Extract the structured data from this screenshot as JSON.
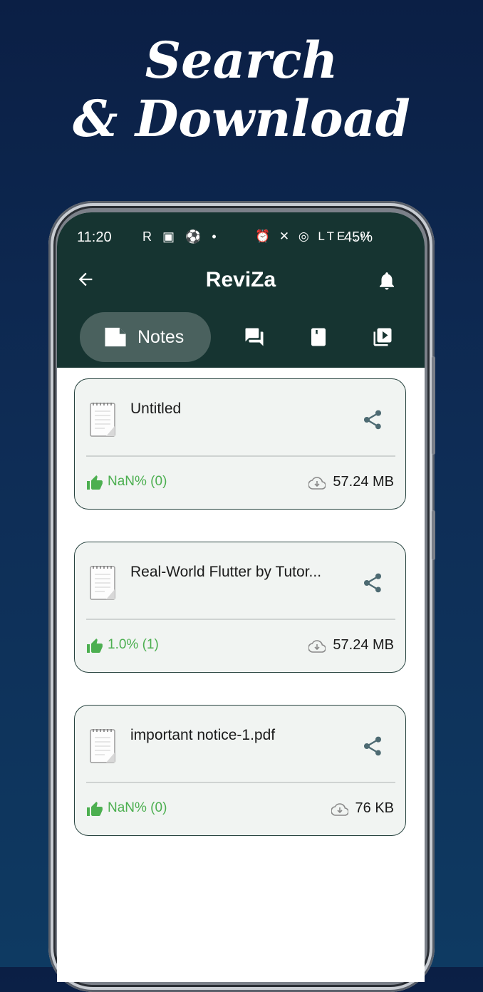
{
  "promo": {
    "line1": "Search",
    "line2": "& Download"
  },
  "status_bar": {
    "time": "11:20",
    "left_icons": "R ▣ ⚽ •",
    "right_icons": "⏰ ✕ ◎ LTE .ıl",
    "battery": "45%"
  },
  "appbar": {
    "title": "ReviZa"
  },
  "tabs": [
    {
      "label": "Notes",
      "icon": "note-icon",
      "selected": true
    },
    {
      "icon": "forum-icon"
    },
    {
      "icon": "book-icon"
    },
    {
      "icon": "video-library-icon"
    }
  ],
  "notes": [
    {
      "title": "Untitled",
      "rating": "NaN% (0)",
      "size": "57.24 MB"
    },
    {
      "title": "Real-World Flutter by Tutor...",
      "rating": "1.0% (1)",
      "size": "57.24 MB"
    },
    {
      "title": "important notice-1.pdf",
      "rating": "NaN% (0)",
      "size": "76 KB"
    }
  ],
  "colors": {
    "appbar": "#163431",
    "selected_tab": "#4a615e",
    "rating_green": "#4caf50",
    "card_border": "#27433f"
  }
}
